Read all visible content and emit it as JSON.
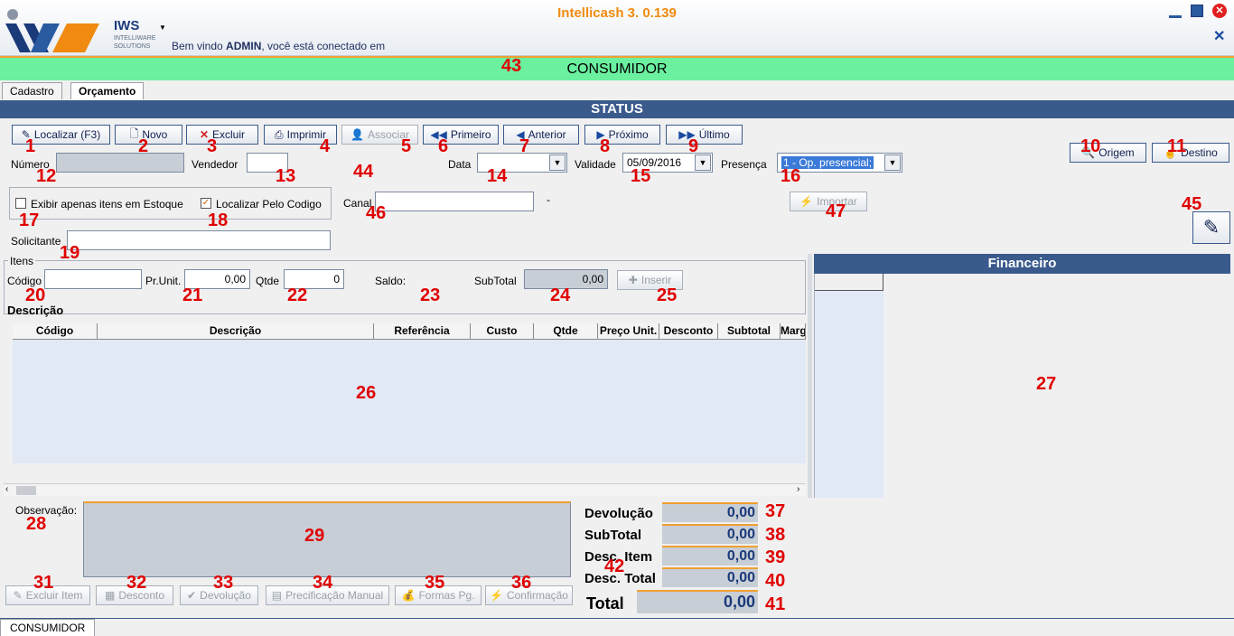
{
  "app": {
    "title": "Intellicash 3. 0.139",
    "welcome_prefix": "Bem vindo ",
    "welcome_user": "ADMIN",
    "welcome_suffix": ", você está conectado em",
    "logo_text": "IWS",
    "logo_sub1": "INTELLIWARE",
    "logo_sub2": "SOLUTIONS"
  },
  "banner": {
    "text": "CONSUMIDOR"
  },
  "tabs": [
    {
      "label": "Cadastro"
    },
    {
      "label": "Orçamento"
    }
  ],
  "status": {
    "text": "STATUS"
  },
  "toolbar": {
    "localizar": "Localizar (F3)",
    "novo": "Novo",
    "excluir": "Excluir",
    "imprimir": "Imprimir",
    "associar": "Associar",
    "primeiro": "Primeiro",
    "anterior": "Anterior",
    "proximo": "Próximo",
    "ultimo": "Último",
    "origem": "Origem",
    "destino": "Destino",
    "importar": "Importar"
  },
  "form": {
    "numero_label": "Número",
    "vendedor_label": "Vendedor",
    "data_label": "Data",
    "validade_label": "Validade",
    "validade_value": "05/09/2016",
    "presenca_label": "Presença",
    "presenca_value": "1 - Op. presencial;",
    "exibir_label": "Exibir apenas itens em Estoque",
    "localizar_codigo_label": "Localizar Pelo Codigo",
    "canal_label": "Canal",
    "canal_suffix": "-",
    "solicitante_label": "Solicitante"
  },
  "itens": {
    "group_label": "Itens",
    "codigo_label": "Código",
    "prunit_label": "Pr.Unit.",
    "prunit_value": "0,00",
    "qtde_label": "Qtde",
    "qtde_value": "0",
    "saldo_label": "Saldo:",
    "subtotal_label": "SubTotal",
    "subtotal_value": "0,00",
    "inserir": "Inserir",
    "descricao_label": "Descrição"
  },
  "grid": {
    "columns": [
      "Código",
      "Descrição",
      "Referência",
      "Custo",
      "Qtde",
      "Preço Unit.",
      "Desconto",
      "Subtotal",
      "Marg"
    ]
  },
  "financeiro": {
    "title": "Financeiro"
  },
  "observacao_label": "Observação:",
  "totals": {
    "devolucao_label": "Devolução",
    "devolucao_value": "0,00",
    "subtotal_label": "SubTotal",
    "subtotal_value": "0,00",
    "desc_item_label": "Desc. Item",
    "desc_item_value": "0,00",
    "desc_total_label": "Desc. Total",
    "desc_total_value": "0,00",
    "total_label": "Total",
    "total_value": "0,00"
  },
  "bottom_buttons": {
    "excluir_item": "Excluir Item",
    "desconto": "Desconto",
    "devolucao": "Devolução",
    "precificacao": "Precificação Manual",
    "formas": "Formas Pg.",
    "confirmacao": "Confirmação"
  },
  "footer_tab": "CONSUMIDOR",
  "markers": [
    "1",
    "2",
    "3",
    "4",
    "5",
    "6",
    "7",
    "8",
    "9",
    "10",
    "11",
    "12",
    "13",
    "14",
    "15",
    "16",
    "17",
    "18",
    "19",
    "20",
    "21",
    "22",
    "23",
    "24",
    "25",
    "26",
    "27",
    "28",
    "29",
    "31",
    "32",
    "33",
    "34",
    "35",
    "36",
    "37",
    "38",
    "39",
    "40",
    "41",
    "42",
    "43",
    "44",
    "45",
    "46",
    "47"
  ],
  "colors": {
    "accent": "#3a5a8c",
    "banner": "#6bf0a0",
    "title": "#f08a10",
    "marker": "#e00000"
  }
}
